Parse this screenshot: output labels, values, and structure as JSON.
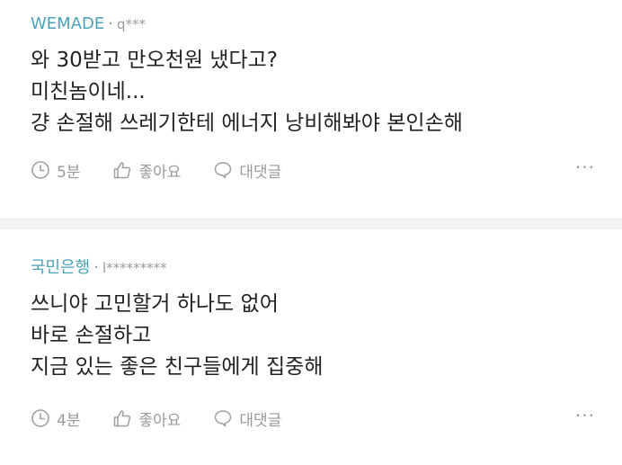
{
  "comments": [
    {
      "author": "WEMADE",
      "separator": "·",
      "masked_id": "q***",
      "lines": [
        "와 30받고 만오천원 냈다고?",
        "미친놈이네...",
        "걍 손절해 쓰레기한테 에너지 낭비해봐야 본인손해"
      ],
      "time": "5분",
      "like_label": "좋아요",
      "reply_label": "대댓글",
      "more": "···"
    },
    {
      "author": "국민은행",
      "separator": "·",
      "masked_id": "l*********",
      "lines": [
        "쓰니야 고민할거 하나도 없어",
        "바로 손절하고",
        "지금 있는 좋은 친구들에게 집중해"
      ],
      "time": "4분",
      "like_label": "좋아요",
      "reply_label": "대댓글",
      "more": "···"
    }
  ],
  "icons": {
    "time": "clock-icon",
    "like": "thumbs-up-icon",
    "reply": "speech-bubble-icon",
    "more": "more-options-icon"
  },
  "colors": {
    "author": "#4aa3b7",
    "meta_gray": "#999999",
    "text": "#222222",
    "divider": "#f1f2f4"
  }
}
